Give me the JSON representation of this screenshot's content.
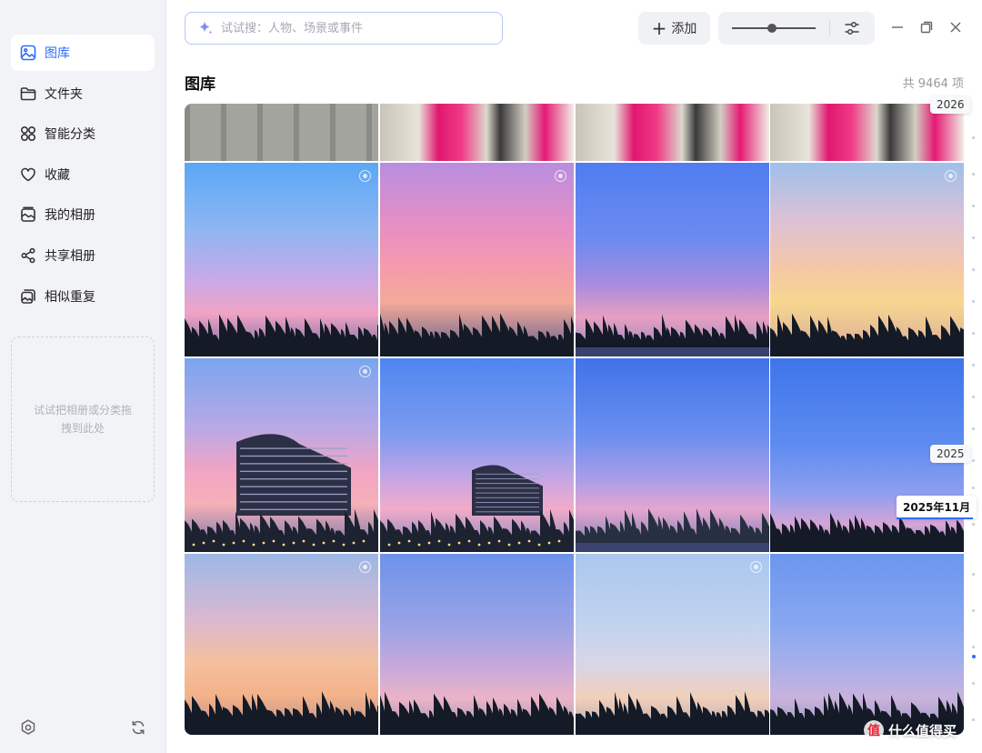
{
  "sidebar": {
    "items": [
      {
        "label": "图库",
        "icon": "image-icon",
        "active": true
      },
      {
        "label": "文件夹",
        "icon": "folder-icon",
        "active": false
      },
      {
        "label": "智能分类",
        "icon": "grid-icon",
        "active": false
      },
      {
        "label": "收藏",
        "icon": "heart-icon",
        "active": false
      },
      {
        "label": "我的相册",
        "icon": "album-icon",
        "active": false
      },
      {
        "label": "共享相册",
        "icon": "share-icon",
        "active": false
      },
      {
        "label": "相似重复",
        "icon": "duplicate-icon",
        "active": false
      }
    ],
    "drop_zone_text": "试试把相册或分类拖拽到此处",
    "bottom_icons": [
      "settings-icon",
      "sync-icon"
    ]
  },
  "search": {
    "placeholder": "试试搜：人物、场景或事件",
    "value": ""
  },
  "toolbar": {
    "add_label": "添加",
    "zoom_level": 0.48
  },
  "colors": {
    "accent": "#2f6bff",
    "sidebar_bg": "#f2f3f7"
  },
  "main": {
    "title": "图库",
    "count_label": "共 9464 项"
  },
  "timeline": {
    "year_tags": [
      "2026",
      "2025"
    ],
    "current_month": "2025年11月"
  },
  "watermark": {
    "symbol": "值",
    "text": "什么值得买"
  }
}
